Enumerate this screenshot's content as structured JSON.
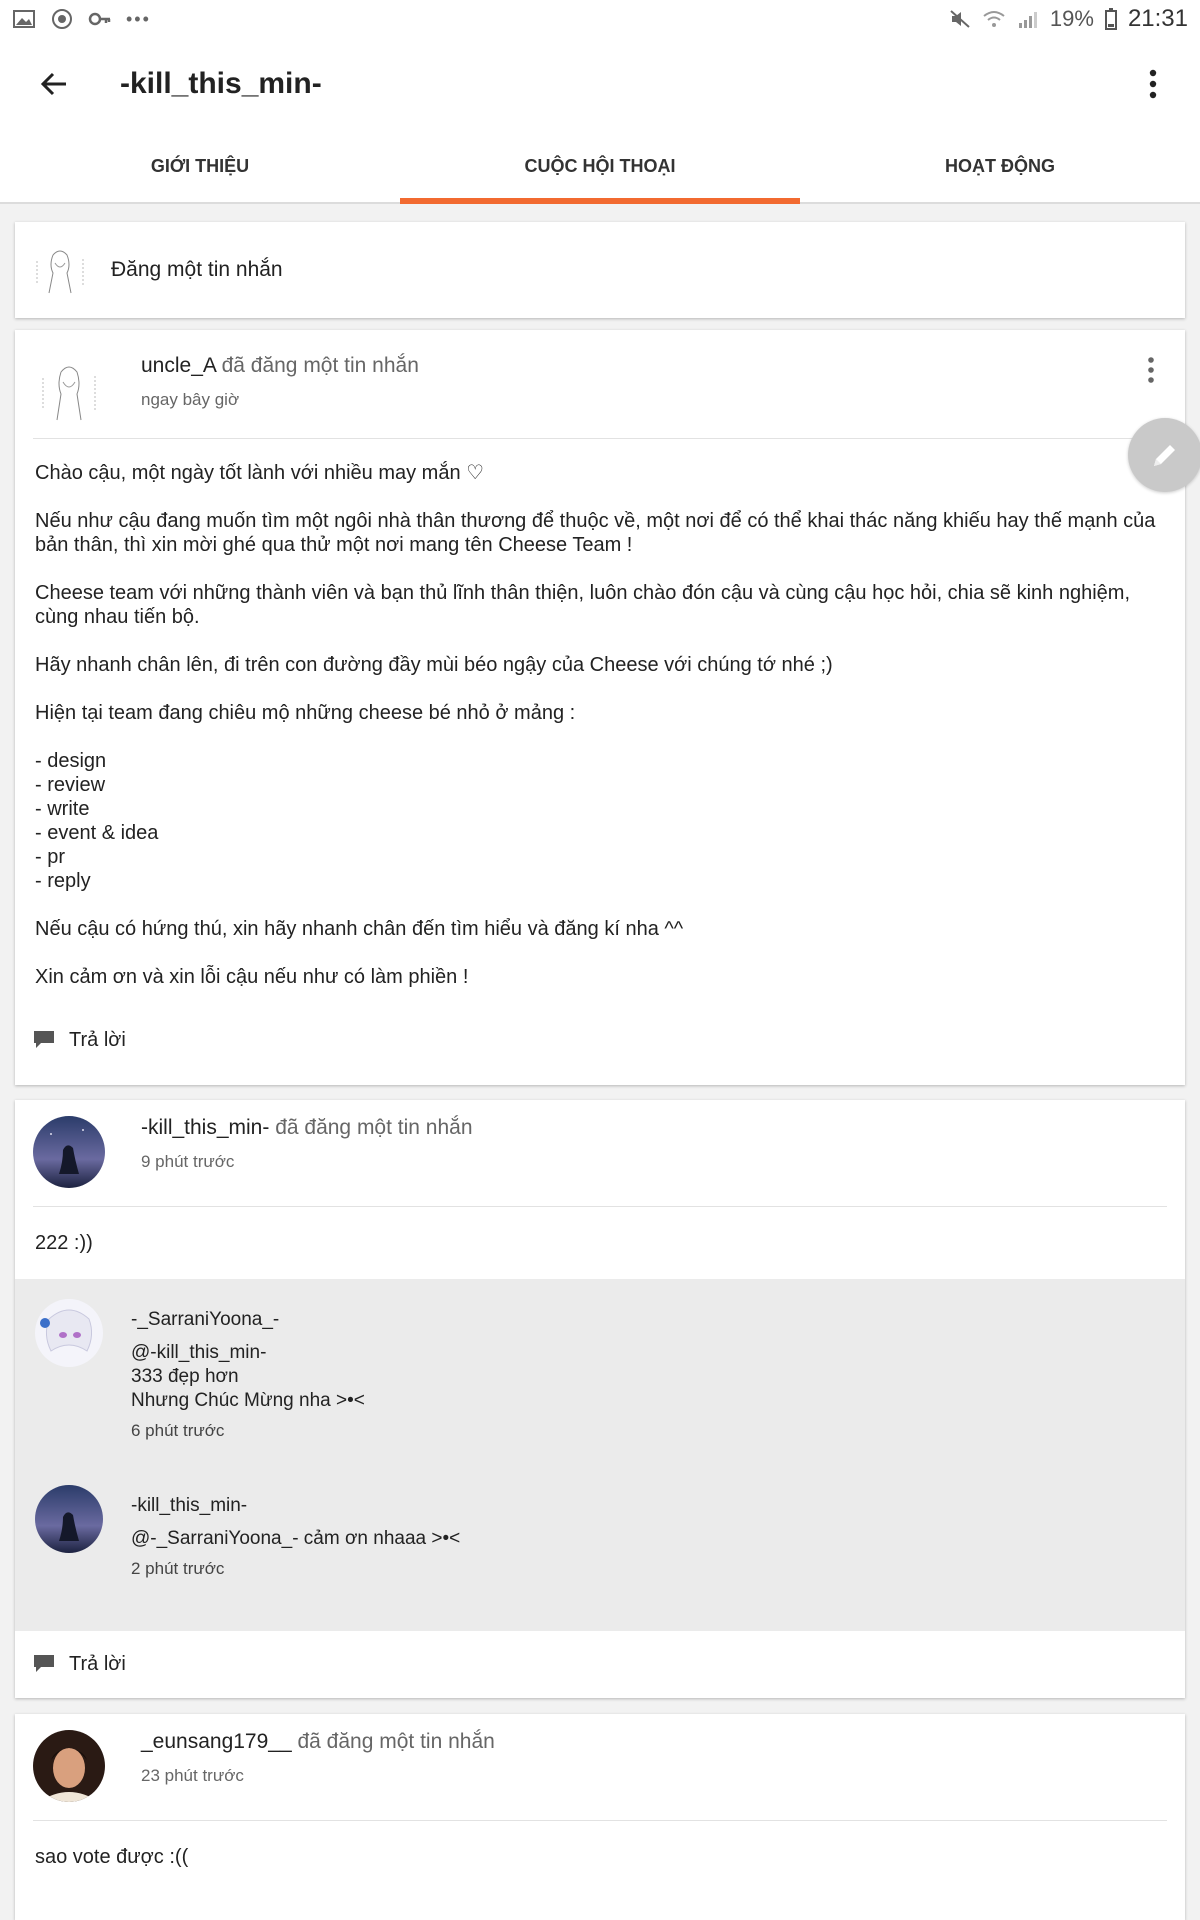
{
  "statusbar": {
    "battery": "19%",
    "time": "21:31"
  },
  "appbar": {
    "title": "-kill_this_min-"
  },
  "tabs": [
    {
      "label": "GIỚI THIỆU",
      "active": false
    },
    {
      "label": "CUỘC HỘI THOẠI",
      "active": true
    },
    {
      "label": "HOẠT ĐỘNG",
      "active": false
    }
  ],
  "colors": {
    "accent": "#f26a30",
    "fab": "#c9c9c9"
  },
  "compose": {
    "label": "Đăng một tin nhắn"
  },
  "posts": [
    {
      "author": "uncle_A",
      "verb": " đã đăng một tin nhắn",
      "time": "ngay bây giờ",
      "paragraphs": [
        "Chào cậu, một ngày tốt lành với nhiều may mắn ♡",
        "Nếu như cậu đang muốn tìm một ngôi nhà thân thương để thuộc về, một nơi để có thể khai thác năng khiếu hay thế mạnh của bản thân, thì xin mời ghé qua thử một nơi mang tên Cheese Team !",
        "Cheese team với những thành viên và bạn thủ lĩnh thân thiện, luôn chào đón cậu và cùng cậu học hỏi, chia sẽ kinh nghiệm, cùng nhau tiến bộ.",
        "Hãy nhanh chân lên, đi trên con đường đầy mùi béo ngậy của Cheese với chúng tớ nhé ;)",
        "Hiện tại team đang chiêu mộ những cheese bé nhỏ ở mảng :",
        "- design\n- review\n- write\n- event & idea\n- pr\n- reply",
        "Nếu cậu có hứng thú, xin hãy nhanh chân đến tìm hiểu và đăng kí nha ^^",
        "Xin cảm ơn và xin lỗi cậu nếu như có làm phiền !"
      ],
      "reply_label": "Trả lời"
    },
    {
      "author": "-kill_this_min-",
      "verb": " đã đăng một tin nhắn",
      "time": "9 phút trước",
      "text": "222 :))",
      "comments": [
        {
          "author": "-_SarraniYoona_-",
          "text": "@-kill_this_min-\n333 đẹp hơn\nNhưng Chúc Mừng nha >•<",
          "time": "6 phút trước"
        },
        {
          "author": "-kill_this_min-",
          "text": "@-_SarraniYoona_- cảm ơn nhaaa >•<",
          "time": "2 phút trước"
        }
      ],
      "reply_label": "Trả lời"
    },
    {
      "author": "_eunsang179__",
      "verb": " đã đăng một tin nhắn",
      "time": "23 phút trước",
      "text": "sao vote được :(("
    }
  ]
}
